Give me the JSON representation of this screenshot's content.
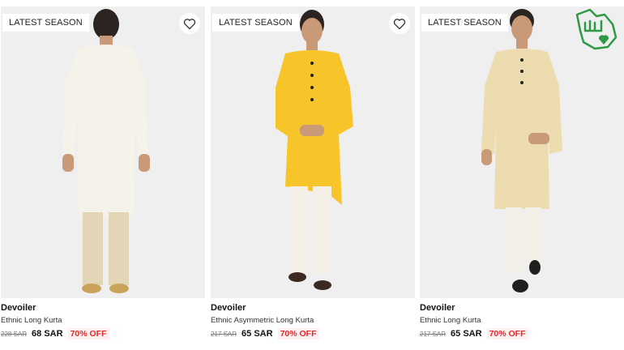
{
  "products": [
    {
      "badge": "LATEST SEASON",
      "brand": "Devoiler",
      "name": "Ethnic Long Kurta",
      "old_price": "228 SAR",
      "price": "68 SAR",
      "discount": "70% OFF",
      "kurta_color": "#f4f2e9",
      "pant_color": "#e3d6b6"
    },
    {
      "badge": "LATEST SEASON",
      "brand": "Devoiler",
      "name": "Ethnic Asymmetric Long Kurta",
      "old_price": "217 SAR",
      "price": "65 SAR",
      "discount": "70% OFF",
      "kurta_color": "#f7c52a",
      "pant_color": "#f3efe6"
    },
    {
      "badge": "LATEST SEASON",
      "brand": "Devoiler",
      "name": "Ethnic Long Kurta",
      "old_price": "217 SAR",
      "price": "65 SAR",
      "discount": "70% OFF",
      "kurta_color": "#ecdcaf",
      "pant_color": "#f3efe6"
    }
  ],
  "icons": {
    "wishlist": "heart-outline-icon",
    "watermark": "saudi-map-logo"
  },
  "colors": {
    "discount": "#e0292f",
    "image_bg": "#efefef",
    "watermark": "#2e9a46"
  }
}
